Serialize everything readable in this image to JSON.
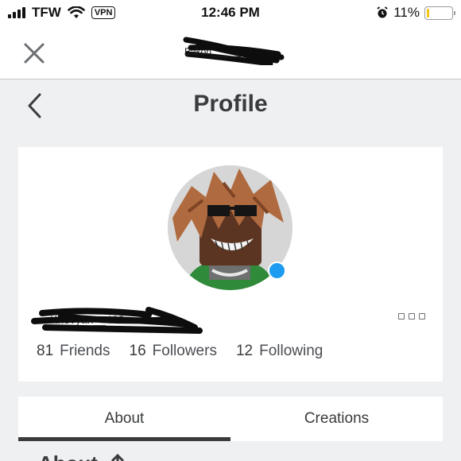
{
  "status_bar": {
    "carrier": "TFW",
    "vpn": "VPN",
    "time": "12:46 PM",
    "battery_percent": "11%",
    "battery_level": 0.11,
    "battery_color": "#f5c518"
  },
  "top_nav": {
    "close_icon": "close-icon",
    "username": "Bakon______"
  },
  "header": {
    "title": "Profile",
    "back_icon": "chevron-left-icon"
  },
  "profile": {
    "username": "Khevyan__402",
    "online_color": "#1c9bf0",
    "stats": [
      {
        "count": "81",
        "label": "Friends"
      },
      {
        "count": "16",
        "label": "Followers"
      },
      {
        "count": "12",
        "label": "Following"
      }
    ]
  },
  "tabs": [
    {
      "label": "About",
      "active": true
    },
    {
      "label": "Creations",
      "active": false
    }
  ],
  "about": {
    "heading": "About"
  }
}
